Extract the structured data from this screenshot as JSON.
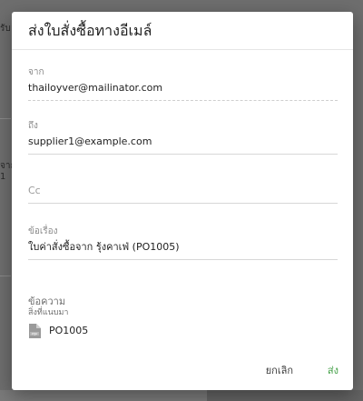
{
  "background": {
    "fragment1": "รับ",
    "fragment2": "จาก",
    "fragment3": "1"
  },
  "dialog": {
    "title": "ส่งใบสั่งซื้อทางอีเมล์",
    "fields": {
      "from": {
        "label": "จาก",
        "value": "thailoyver@mailinator.com"
      },
      "to": {
        "label": "ถึง",
        "value": "supplier1@example.com"
      },
      "cc": {
        "placeholder": "Cc"
      },
      "subject": {
        "label": "ข้อเรื่อง",
        "value": "ใบค่าสั่งซื้อจาก รุ้งคาเฟ่ (PO1005)"
      }
    },
    "message": {
      "label": "ข้อความ",
      "attachments_label": "สิ่งที่แนบมา",
      "attachment": {
        "name": "PO1005",
        "icon": "pdf-file-icon"
      }
    },
    "actions": {
      "cancel_label": "ยกเลิก",
      "send_label": "ส่ง"
    }
  },
  "colors": {
    "send_accent": "#43a047",
    "overlay": "#6e6e6e"
  }
}
